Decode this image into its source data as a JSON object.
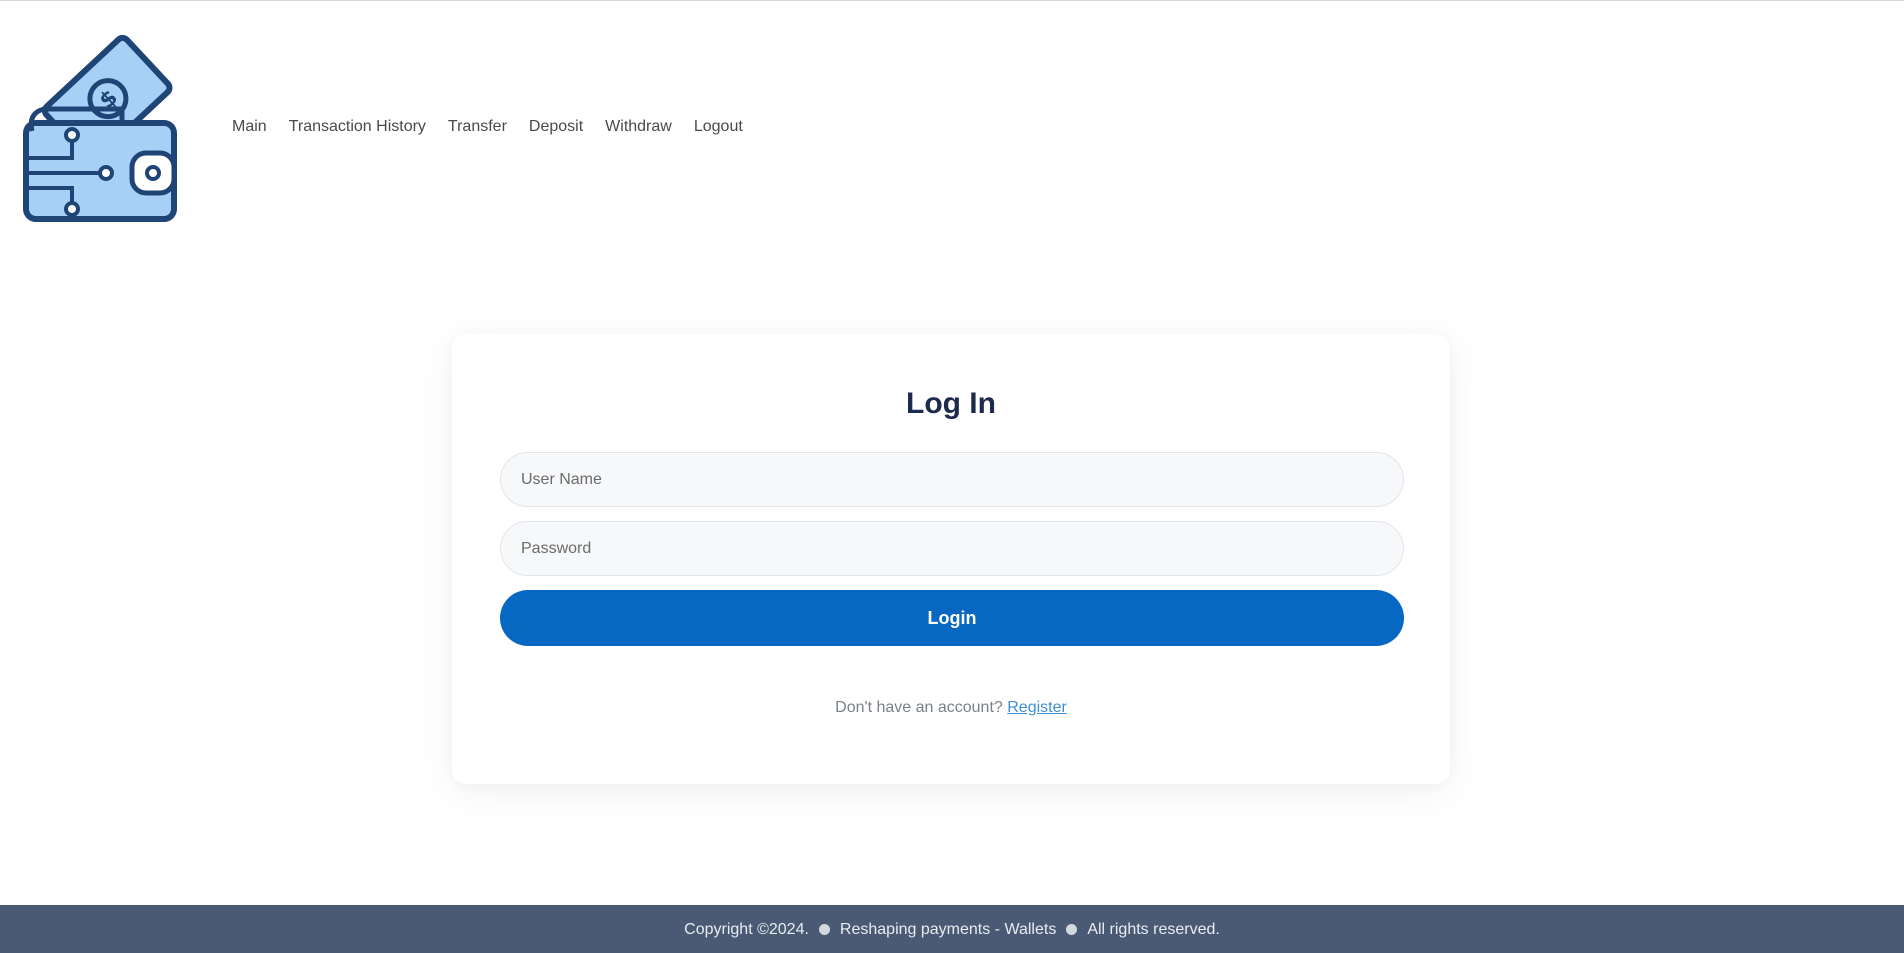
{
  "header": {
    "logo_alt": "wallet-logo",
    "nav": [
      {
        "label": "Main"
      },
      {
        "label": "Transaction History"
      },
      {
        "label": "Transfer"
      },
      {
        "label": "Deposit"
      },
      {
        "label": "Withdraw"
      },
      {
        "label": "Logout"
      }
    ]
  },
  "login": {
    "title": "Log In",
    "username_placeholder": "User Name",
    "password_placeholder": "Password",
    "button_label": "Login",
    "register_prompt": "Don't have an account?",
    "register_link": "Register"
  },
  "footer": {
    "part1": "Copyright ©2024.",
    "part2": "Reshaping payments - Wallets",
    "part3": "All rights reserved."
  },
  "colors": {
    "primary": "#0668c2",
    "footer_bg": "#4b5a74",
    "title": "#1d2a4d",
    "logo_fill": "#a6d0f5",
    "logo_stroke": "#1e4575"
  }
}
